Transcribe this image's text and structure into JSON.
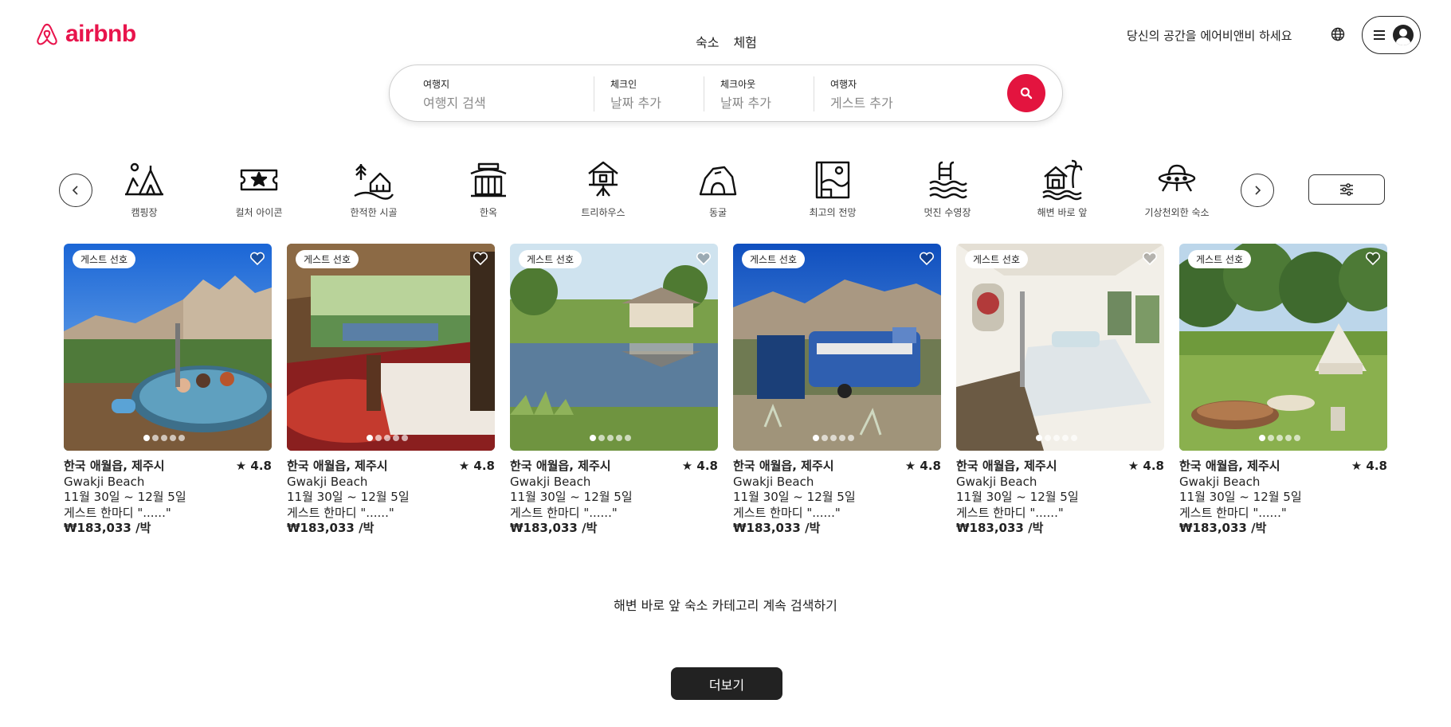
{
  "brand": {
    "name": "airbnb",
    "color": "#e8144c"
  },
  "header": {
    "tabs": [
      "숙소",
      "체험"
    ],
    "host_link": "당신의 공간을 에어비앤비 하세요",
    "globe_icon": "globe-icon",
    "menu_icon": "hamburger-icon",
    "avatar_icon": "user-avatar-icon"
  },
  "search": {
    "where": {
      "label": "여행지",
      "placeholder": "여행지 검색"
    },
    "checkin": {
      "label": "체크인",
      "placeholder": "날짜 추가"
    },
    "checkout": {
      "label": "체크아웃",
      "placeholder": "날짜 추가"
    },
    "guests": {
      "label": "여행자",
      "placeholder": "게스트 추가"
    },
    "button_color": "#e3143f"
  },
  "categories": [
    {
      "label": "캠핑장",
      "icon": "camping-icon"
    },
    {
      "label": "컬처 아이콘",
      "icon": "ticket-star-icon"
    },
    {
      "label": "한적한 시골",
      "icon": "countryside-icon"
    },
    {
      "label": "한옥",
      "icon": "hanok-icon"
    },
    {
      "label": "트리하우스",
      "icon": "treehouse-icon"
    },
    {
      "label": "동굴",
      "icon": "cave-icon"
    },
    {
      "label": "최고의 전망",
      "icon": "view-icon"
    },
    {
      "label": "멋진 수영장",
      "icon": "pool-icon"
    },
    {
      "label": "해변 바로 앞",
      "icon": "beachfront-icon"
    },
    {
      "label": "기상천외한 숙소",
      "icon": "ufo-icon"
    }
  ],
  "listings": [
    {
      "badge": "게스트 선호",
      "location": "한국 애월읍, 제주시",
      "rating": "★ 4.8",
      "subtitle": "Gwakji Beach",
      "dates": "11월 30일 ~ 12월 5일",
      "review": "게스트 한마디 \"......\"",
      "price": "₩183,033 /박",
      "scene": "hottub"
    },
    {
      "badge": "게스트 선호",
      "location": "한국 애월읍, 제주시",
      "rating": "★ 4.8",
      "subtitle": "Gwakji Beach",
      "dates": "11월 30일 ~ 12월 5일",
      "review": "게스트 한마디 \"......\"",
      "price": "₩183,033 /박",
      "scene": "tent-bed"
    },
    {
      "badge": "게스트 선호",
      "location": "한국 애월읍, 제주시",
      "rating": "★ 4.8",
      "subtitle": "Gwakji Beach",
      "dates": "11월 30일 ~ 12월 5일",
      "review": "게스트 한마디 \"......\"",
      "price": "₩183,033 /박",
      "scene": "lake-cabin"
    },
    {
      "badge": "게스트 선호",
      "location": "한국 애월읍, 제주시",
      "rating": "★ 4.8",
      "subtitle": "Gwakji Beach",
      "dates": "11월 30일 ~ 12월 5일",
      "review": "게스트 한마디 \"......\"",
      "price": "₩183,033 /박",
      "scene": "blue-caravan"
    },
    {
      "badge": "게스트 선호",
      "location": "한국 애월읍, 제주시",
      "rating": "★ 4.8",
      "subtitle": "Gwakji Beach",
      "dates": "11월 30일 ~ 12월 5일",
      "review": "게스트 한마디 \"......\"",
      "price": "₩183,033 /박",
      "scene": "bus-interior"
    },
    {
      "badge": "게스트 선호",
      "location": "한국 애월읍, 제주시",
      "rating": "★ 4.8",
      "subtitle": "Gwakji Beach",
      "dates": "11월 30일 ~ 12월 5일",
      "review": "게스트 한마디 \"......\"",
      "price": "₩183,033 /박",
      "scene": "bell-tent"
    }
  ],
  "footer": {
    "continue_text": "해변 바로 앞 숙소 카테고리 계속 검색하기",
    "more_button": "더보기"
  }
}
